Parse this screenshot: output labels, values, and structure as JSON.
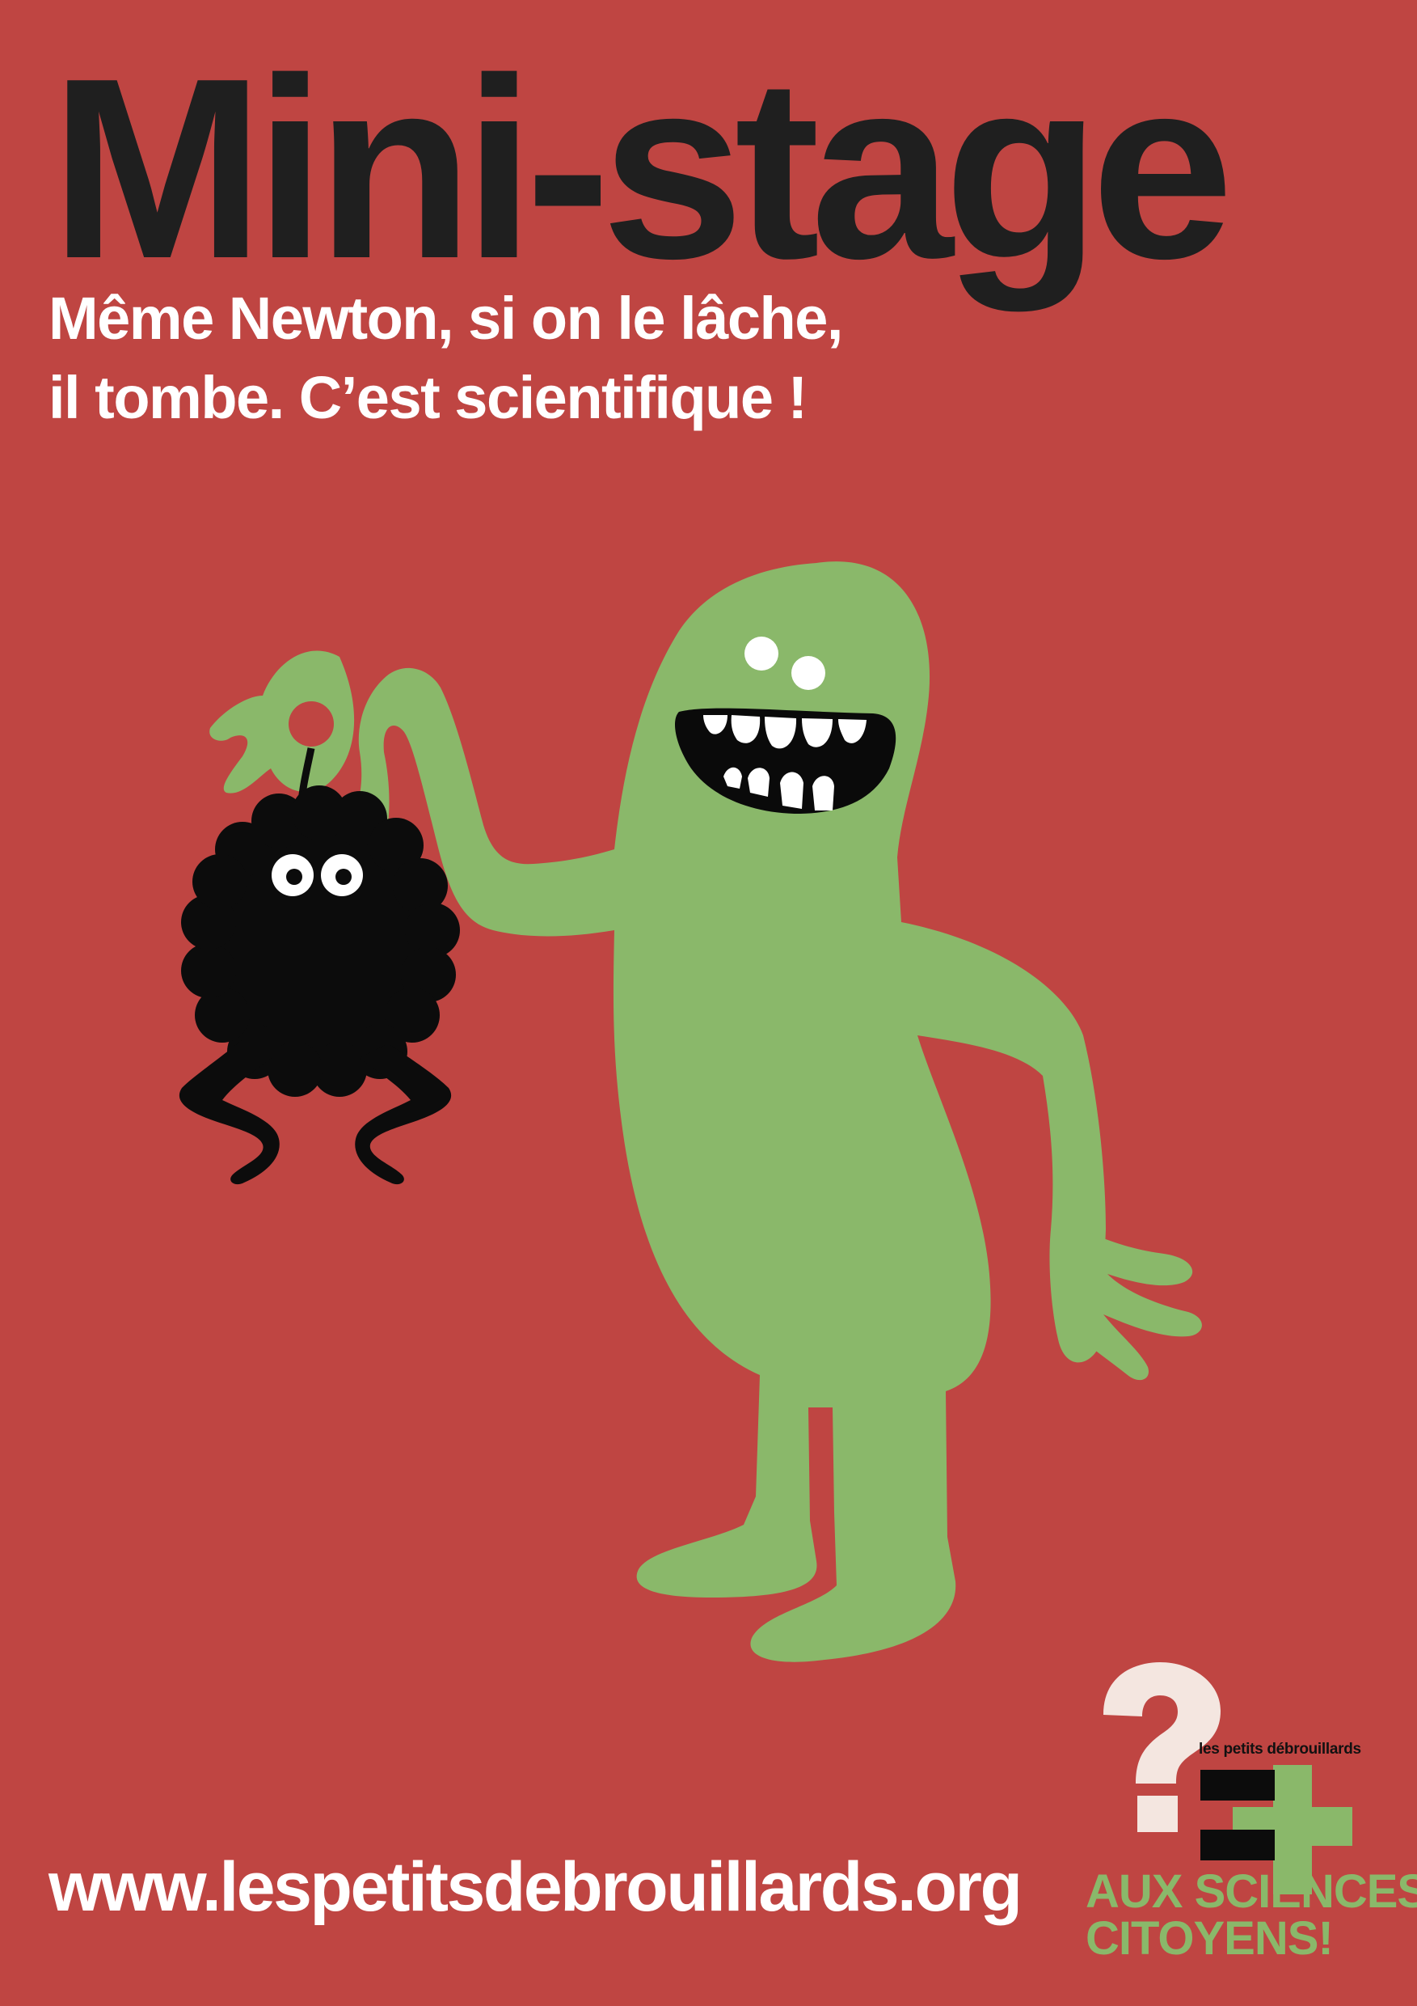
{
  "poster": {
    "title": "Mini-stage",
    "subtitle_line1": "Même Newton, si on le lâche,",
    "subtitle_line2": "il tombe. C’est scientifique !",
    "website": "www.lespetitsdebrouillards.org"
  },
  "logo": {
    "org_name": "les petits débrouillards",
    "tagline_line1": "AUX SCIENCES",
    "tagline_line2": "CITOYENS!"
  },
  "colors": {
    "background": "#bf4542",
    "title": "#1f1f1f",
    "monster_green": "#8ab86a",
    "fuzzy_black": "#0c0c0c"
  },
  "icons": [
    "green-monster-illustration",
    "black-fuzzy-creature-illustration",
    "question-mark-equals-plus-logo"
  ]
}
